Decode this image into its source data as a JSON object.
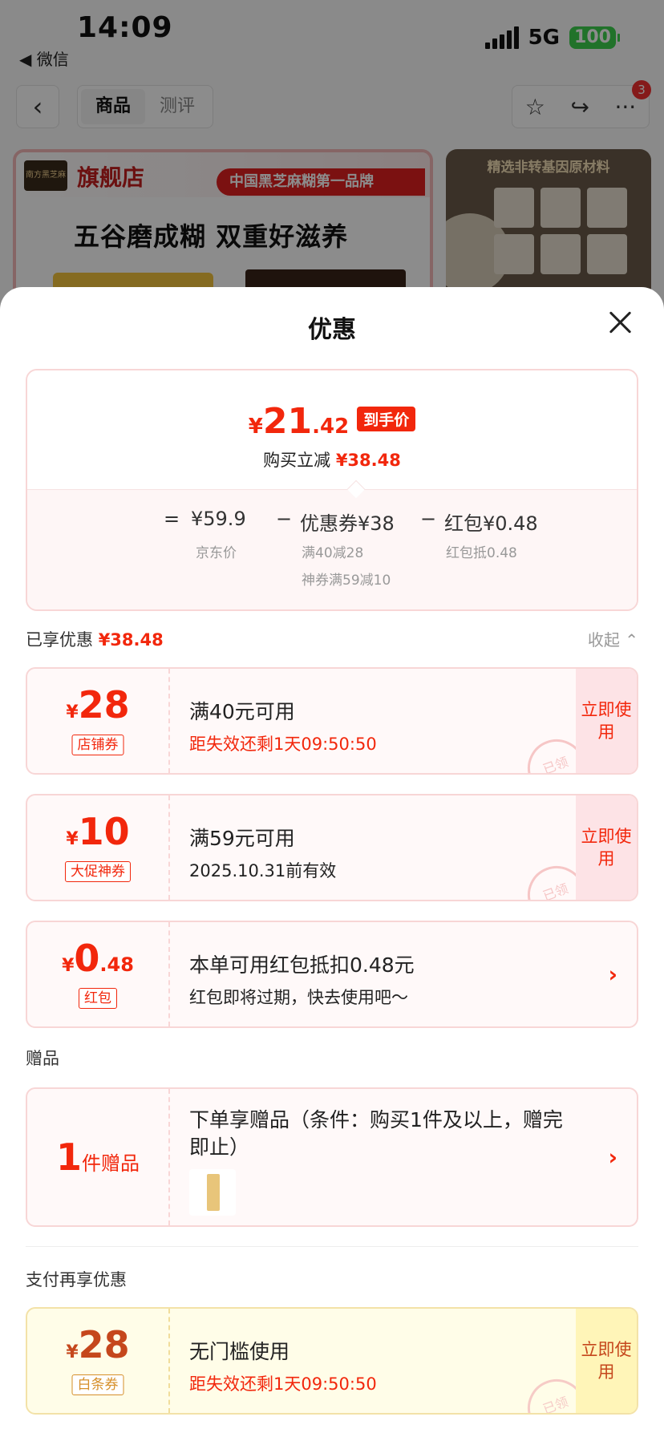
{
  "status_bar": {
    "time": "14:09",
    "back_app": "◀ 微信",
    "network": "5G",
    "battery": "100"
  },
  "product_nav": {
    "tabs": [
      {
        "label": "商品"
      },
      {
        "label": "测评"
      }
    ],
    "cart_badge": "3"
  },
  "banner": {
    "store_label": "旗舰店",
    "slogan": "中国黑芝麻糊第一品牌",
    "headline": "五谷磨成糊 双重好滋养",
    "side_title": "精选非转基因原材料"
  },
  "sheet": {
    "title": "优惠",
    "price": {
      "yen": "¥",
      "integer": "21",
      "decimal": ".42",
      "tag": "到手价",
      "save_label": "购买立减",
      "save_amount": "¥38.48"
    },
    "formula": {
      "equals": "=",
      "base_price": "¥59.9",
      "base_label": "京东价",
      "minus1": "−",
      "coupon_amount": "优惠券¥38",
      "coupon_detail1": "满40减28",
      "coupon_detail2": "神券满59减10",
      "minus2": "−",
      "redpack_amount": "红包¥0.48",
      "redpack_detail": "红包抵0.48"
    },
    "enjoyed_label": "已享优惠",
    "enjoyed_amount": "¥38.48",
    "collapse_label": "收起",
    "coupons": [
      {
        "yen": "¥",
        "amount": "28",
        "decimal": "",
        "tag": "店铺券",
        "title": "满40元可用",
        "subtitle": "距失效还剩1天09:50:50",
        "action": "立即使用",
        "stamp": "已领"
      },
      {
        "yen": "¥",
        "amount": "10",
        "decimal": "",
        "tag": "大促神券",
        "title": "满59元可用",
        "subtitle": "2025.10.31前有效",
        "action": "立即使用",
        "stamp": "已领"
      },
      {
        "yen": "¥",
        "amount": "0",
        "decimal": ".48",
        "tag": "红包",
        "title": "本单可用红包抵扣0.48元",
        "subtitle": "红包即将过期，快去使用吧～",
        "action": ""
      }
    ],
    "gift_section_label": "赠品",
    "gift": {
      "count": "1",
      "unit": "件赠品",
      "text": "下单享赠品（条件：购买1件及以上，赠完即止）"
    },
    "pay_section_label": "支付再享优惠",
    "pay_coupon": {
      "yen": "¥",
      "amount": "28",
      "tag": "白条券",
      "title": "无门槛使用",
      "subtitle": "距失效还剩1天09:50:50",
      "action": "立即使用",
      "stamp": "已领"
    }
  }
}
